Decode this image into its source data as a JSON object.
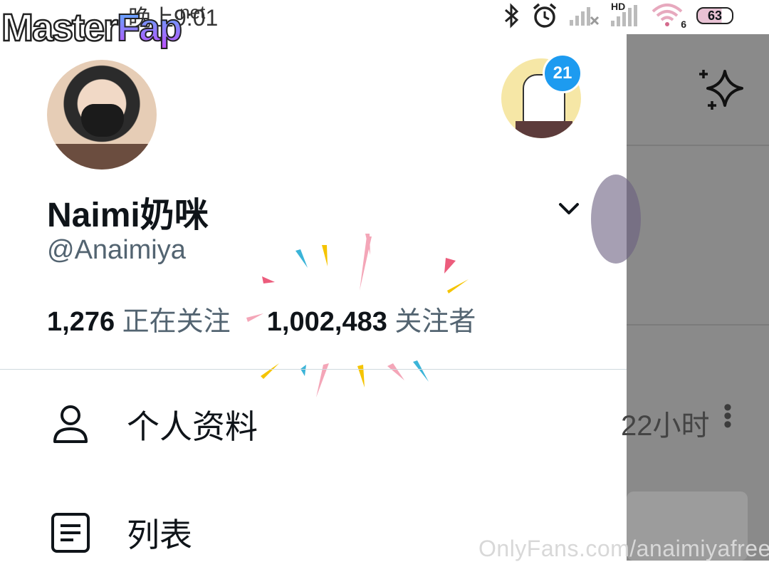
{
  "status_bar": {
    "time": "晚上9:01",
    "network_label": "HD",
    "wifi_number": "6",
    "battery": "63"
  },
  "watermark": {
    "logo_part1": "Master",
    "logo_part2": "Fap",
    "logo_suffix": ".net",
    "footer": "OnlyFans.com/anaimiyafree"
  },
  "profile": {
    "display_name": "Naimi奶咪",
    "handle": "@Anaimiya",
    "following_count": "1,276",
    "following_label": "正在关注",
    "followers_count": "1,002,483",
    "followers_label": "关注者",
    "other_account_badge": "21"
  },
  "menu": {
    "items": [
      {
        "label": "个人资料",
        "icon": "person-icon"
      },
      {
        "label": "列表",
        "icon": "list-icon"
      }
    ]
  },
  "background_app": {
    "timestamp": "22小时"
  },
  "colors": {
    "accent": "#1d9bf0",
    "secondary_text": "#536471",
    "overlay": "#8a8a8a"
  }
}
